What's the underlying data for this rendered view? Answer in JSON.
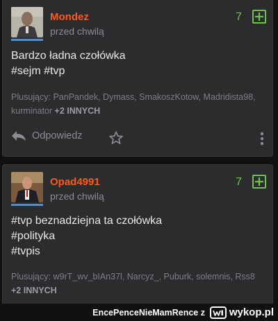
{
  "colors": {
    "background": "#111112",
    "card": "#2b2c2e",
    "username": "#ff5917",
    "vote_green": "#6fc34b",
    "avatar_underline": "#4e8fd0",
    "muted": "#8b8d90"
  },
  "posts": [
    {
      "username": "Mondez",
      "time": "przed chwilą",
      "votes": "7",
      "lines": [
        "Bardzo ładna czołówka",
        "#sejm #tvp"
      ],
      "voters_label": "Plusujący:",
      "voters_names": "PanPandek, Dymass, SmakoszKotow, Madridista98, kurminator",
      "voters_more": "+2 INNYCH",
      "reply_label": "Odpowiedz"
    },
    {
      "username": "Opad4991",
      "time": "przed chwilą",
      "votes": "7",
      "lines": [
        "#tvp beznadziejna ta czołówka",
        "#polityka",
        "#tvpis"
      ],
      "voters_label": "Plusujący:",
      "voters_names": "w9rT_wv_bIAn37l, Narcyz_, Puburk, solemnis, Rss8",
      "voters_more": "+2 INNYCH"
    }
  ],
  "watermark": {
    "user": "EncePenceNieMamRence",
    "separator": "z",
    "site": "wykop.pl"
  }
}
